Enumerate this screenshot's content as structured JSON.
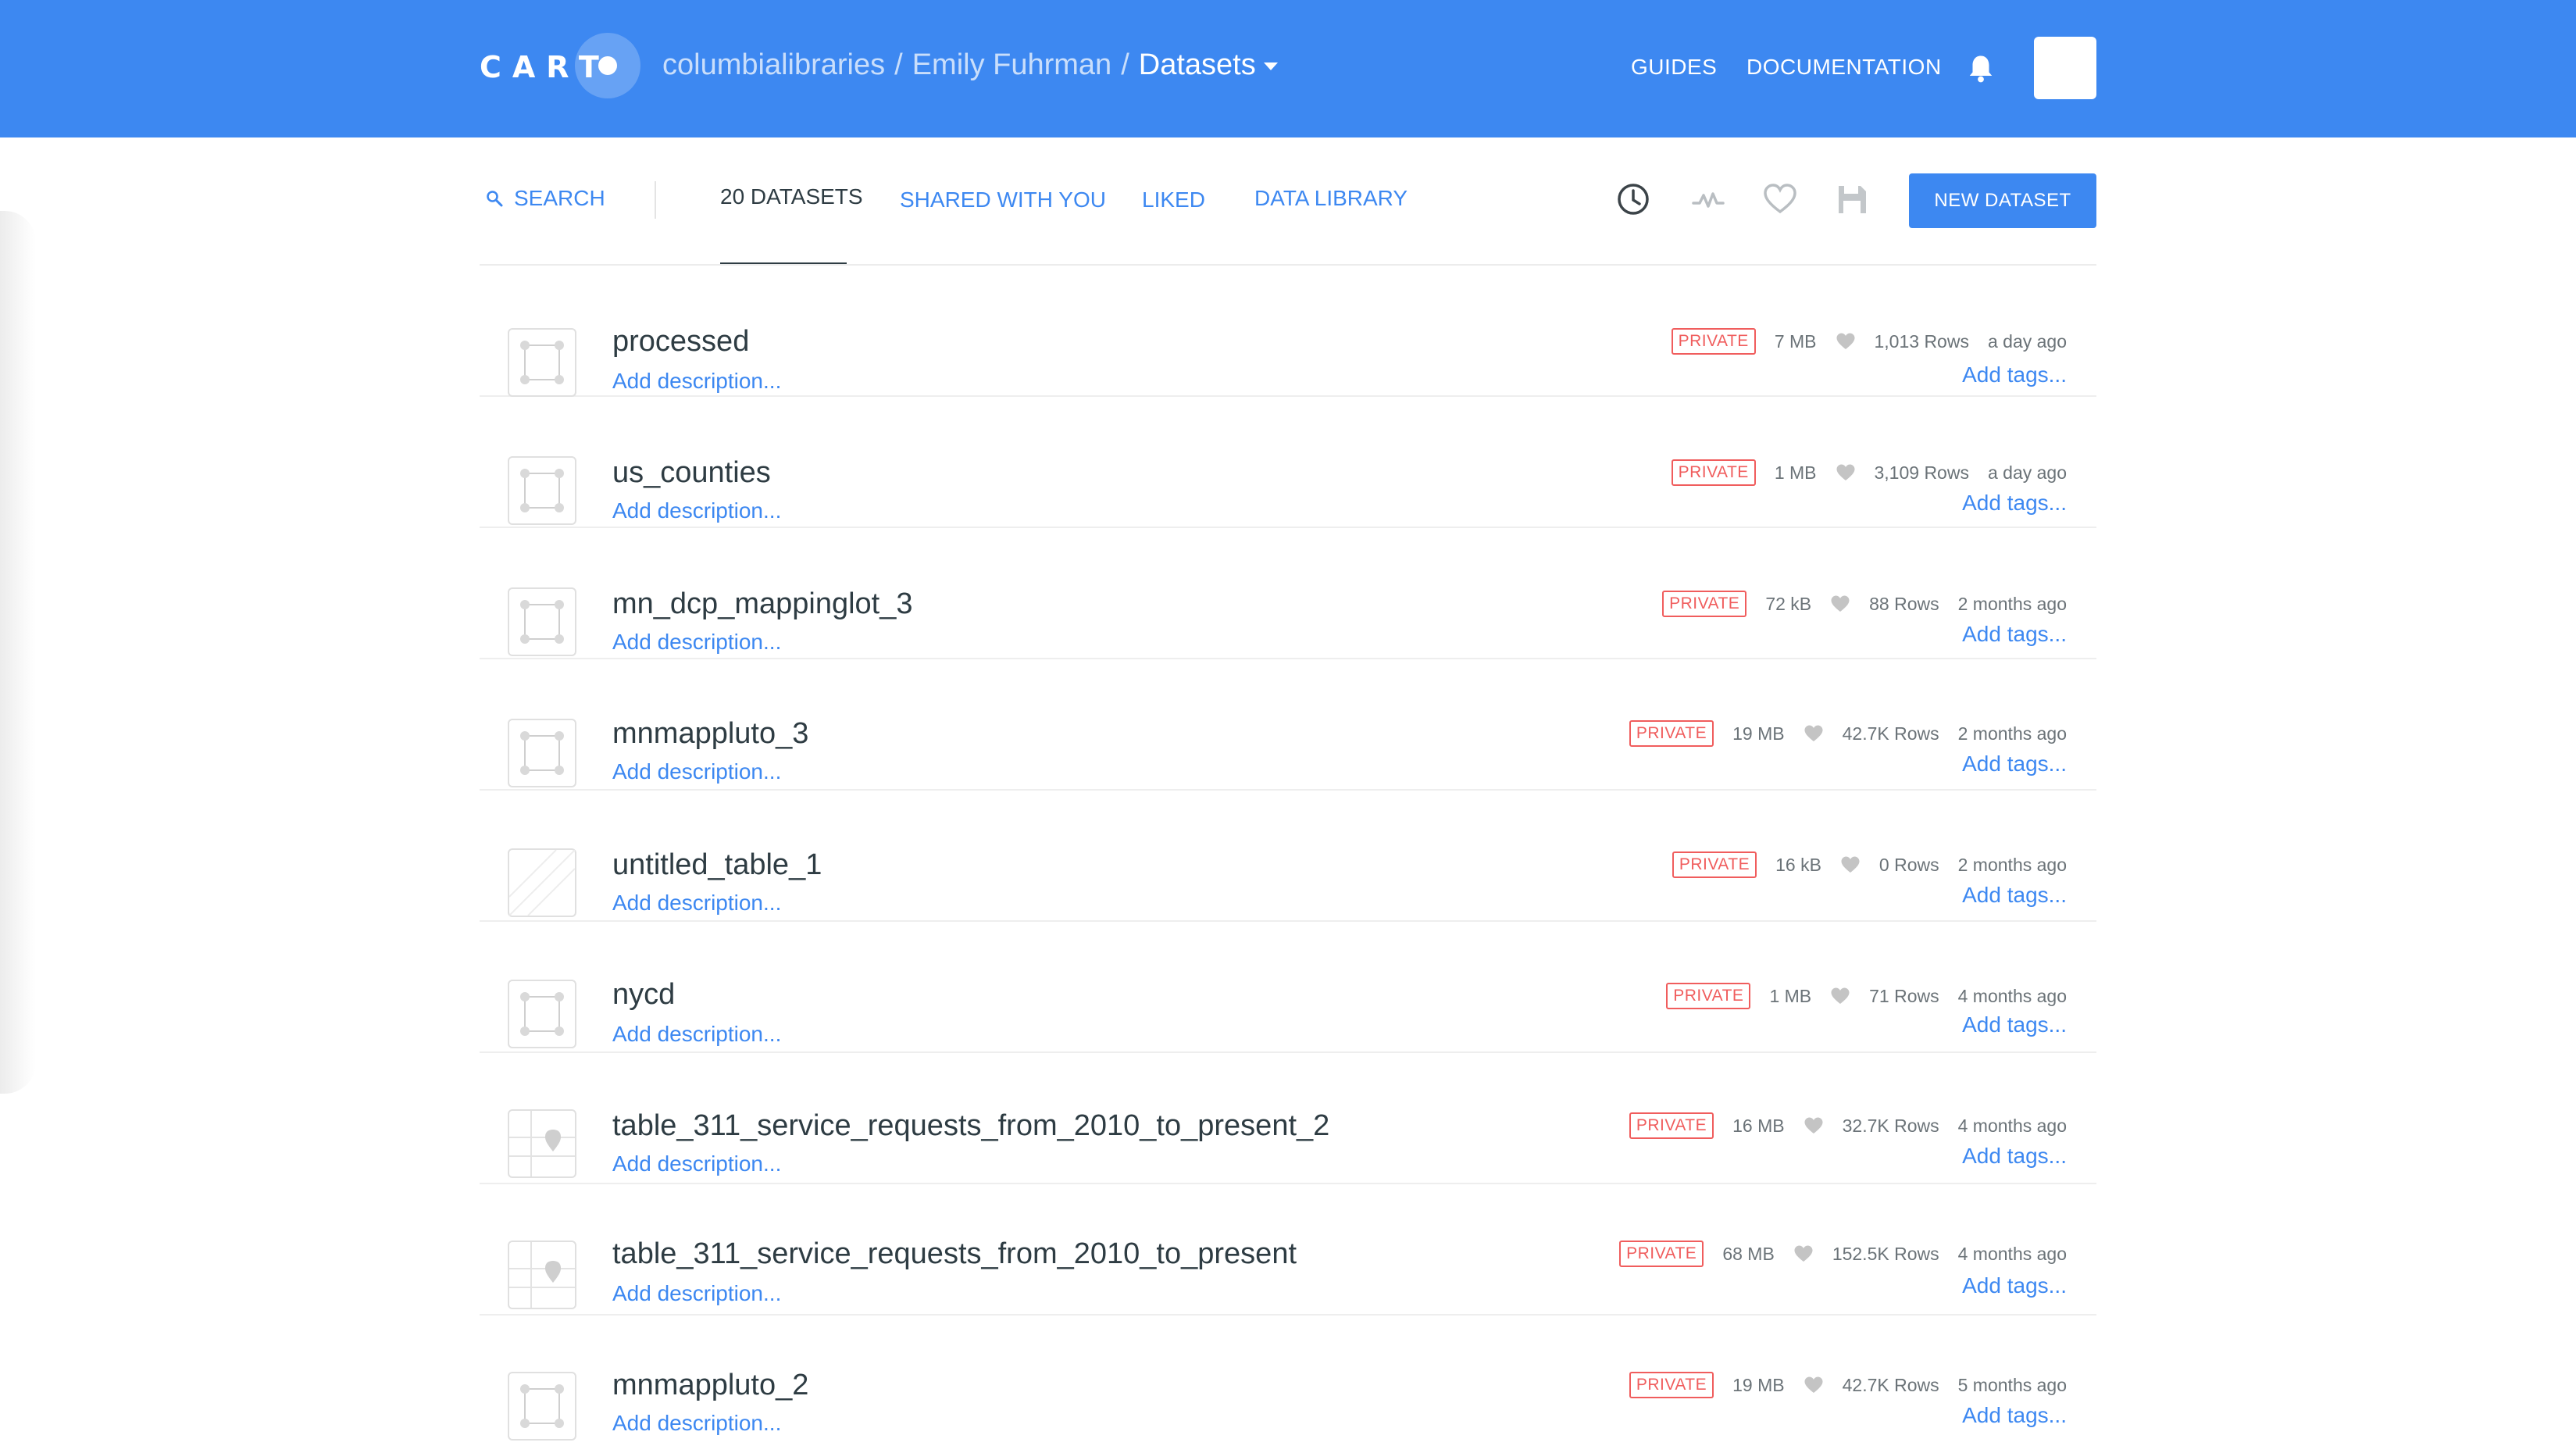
{
  "app": {
    "logo_text": "CART",
    "name": "CARTO"
  },
  "colors": {
    "header": "#3d88f1",
    "accent": "#3d88f1",
    "private_badge": "#f05d5d"
  },
  "breadcrumb": {
    "org": "columbialibraries",
    "user": "Emily Fuhrman",
    "current": "Datasets",
    "separator": "/"
  },
  "top_nav": {
    "guides": "GUIDES",
    "documentation": "DOCUMENTATION",
    "notifications_icon": "bell-icon"
  },
  "toolbar": {
    "search_label": "SEARCH",
    "tabs": [
      {
        "label": "20 DATASETS",
        "active": true
      },
      {
        "label": "SHARED WITH YOU",
        "active": false
      },
      {
        "label": "LIKED",
        "active": false
      },
      {
        "label": "DATA LIBRARY",
        "active": false
      }
    ],
    "icons": [
      "clock-icon",
      "activity-icon",
      "heart-icon",
      "save-icon"
    ],
    "new_button": "NEW DATASET"
  },
  "datasets": [
    {
      "name": "processed",
      "description": "Add description...",
      "privacy": "PRIVATE",
      "size": "7 MB",
      "rows": "1,013 Rows",
      "updated": "a day ago",
      "tags": "Add tags...",
      "thumb": "polygon"
    },
    {
      "name": "us_counties",
      "description": "Add description...",
      "privacy": "PRIVATE",
      "size": "1 MB",
      "rows": "3,109 Rows",
      "updated": "a day ago",
      "tags": "Add tags...",
      "thumb": "polygon"
    },
    {
      "name": "mn_dcp_mappinglot_3",
      "description": "Add description...",
      "privacy": "PRIVATE",
      "size": "72 kB",
      "rows": "88 Rows",
      "updated": "2 months ago",
      "tags": "Add tags...",
      "thumb": "polygon"
    },
    {
      "name": "mnmappluto_3",
      "description": "Add description...",
      "privacy": "PRIVATE",
      "size": "19 MB",
      "rows": "42.7K Rows",
      "updated": "2 months ago",
      "tags": "Add tags...",
      "thumb": "polygon"
    },
    {
      "name": "untitled_table_1",
      "description": "Add description...",
      "privacy": "PRIVATE",
      "size": "16 kB",
      "rows": "0 Rows",
      "updated": "2 months ago",
      "tags": "Add tags...",
      "thumb": "empty"
    },
    {
      "name": "nycd",
      "description": "Add description...",
      "privacy": "PRIVATE",
      "size": "1 MB",
      "rows": "71 Rows",
      "updated": "4 months ago",
      "tags": "Add tags...",
      "thumb": "polygon"
    },
    {
      "name": "table_311_service_requests_from_2010_to_present_2",
      "description": "Add description...",
      "privacy": "PRIVATE",
      "size": "16 MB",
      "rows": "32.7K Rows",
      "updated": "4 months ago",
      "tags": "Add tags...",
      "thumb": "point"
    },
    {
      "name": "table_311_service_requests_from_2010_to_present",
      "description": "Add description...",
      "privacy": "PRIVATE",
      "size": "68 MB",
      "rows": "152.5K Rows",
      "updated": "4 months ago",
      "tags": "Add tags...",
      "thumb": "point"
    },
    {
      "name": "mnmappluto_2",
      "description": "Add description...",
      "privacy": "PRIVATE",
      "size": "19 MB",
      "rows": "42.7K Rows",
      "updated": "5 months ago",
      "tags": "Add tags...",
      "thumb": "polygon"
    }
  ]
}
